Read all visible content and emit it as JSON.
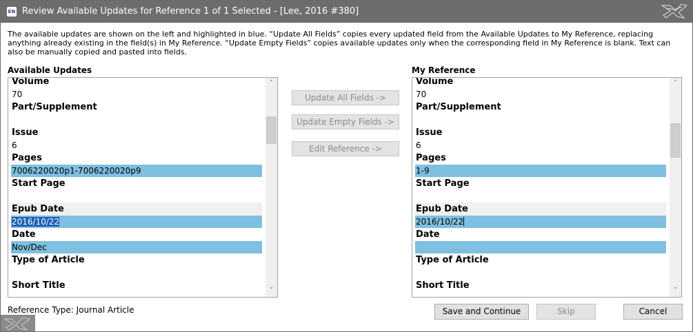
{
  "window": {
    "title": "Review Available Updates for Reference 1 of 1 Selected - [Lee, 2016 #380]",
    "app_icon_text": "EN"
  },
  "description": "The available updates are shown on the left and highlighted in blue. “Update All Fields” copies every updated field from the Available Updates to My Reference, replacing anything already existing in the field(s) in My Reference. “Update Empty Fields” copies available updates only when the corresponding field in My Reference is blank. Text can also be manually copied and pasted into fields.",
  "left_panel": {
    "label": "Available Updates",
    "fields": [
      {
        "name": "Volume",
        "value": "70"
      },
      {
        "name": "Part/Supplement",
        "value": ""
      },
      {
        "name": "Issue",
        "value": "6"
      },
      {
        "name": "Pages",
        "value": "7006220020p1-7006220020p9"
      },
      {
        "name": "Start Page",
        "value": ""
      },
      {
        "name": "Epub Date",
        "value": "2016/10/22"
      },
      {
        "name": "Date",
        "value": "Nov/Dec"
      },
      {
        "name": "Type of Article",
        "value": ""
      },
      {
        "name": "Short Title",
        "value": ""
      }
    ]
  },
  "right_panel": {
    "label": "My Reference",
    "fields": [
      {
        "name": "Volume",
        "value": "70"
      },
      {
        "name": "Part/Supplement",
        "value": ""
      },
      {
        "name": "Issue",
        "value": "6"
      },
      {
        "name": "Pages",
        "value": "1-9"
      },
      {
        "name": "Start Page",
        "value": ""
      },
      {
        "name": "Epub Date",
        "value": "2016/10/22"
      },
      {
        "name": "Date",
        "value": ""
      },
      {
        "name": "Type of Article",
        "value": ""
      },
      {
        "name": "Short Title",
        "value": ""
      }
    ]
  },
  "middle_buttons": {
    "update_all": "Update All Fields ->",
    "update_empty": "Update Empty Fields ->",
    "edit_reference": "Edit Reference ->"
  },
  "footer": {
    "reference_type": "Reference Type: Journal Article",
    "save_continue": "Save and Continue",
    "skip": "Skip",
    "cancel": "Cancel"
  },
  "colors": {
    "titlebar": "#6d6d6d",
    "highlight": "#7fbfe0",
    "selection": "#1e5fb5"
  }
}
